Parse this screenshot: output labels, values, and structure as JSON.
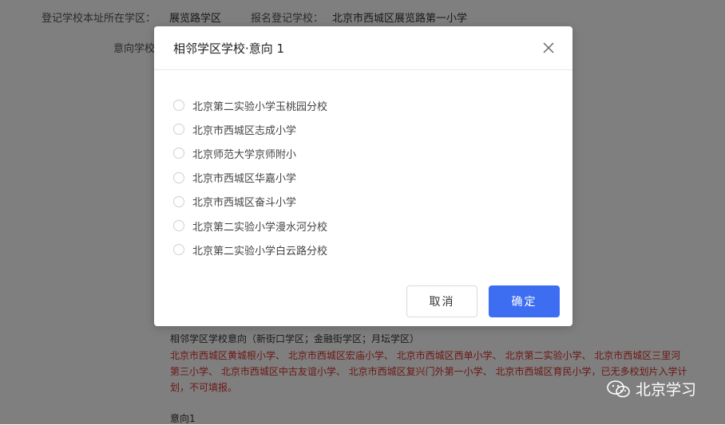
{
  "background": {
    "registered_district_label": "登记学校本址所在学区：",
    "registered_district_value": "展览路学区",
    "registered_school_label": "报名登记学校：",
    "registered_school_value": "北京市西城区展览路第一小学",
    "intent_school_label": "意向学校",
    "adjacent_heading": "相邻学区学校意向（新街口学区；金融街学区；月坛学区）",
    "adjacent_notice": "北京市西城区黄城根小学、 北京市西城区宏庙小学、 北京市西城区西单小学、 北京第二实验小学、 北京市西城区三里河第三小学、 北京市西城区中古友谊小学、 北京市西城区复兴门外第一小学、 北京市西城区育民小学，已无多校划片入学计划，不可填报。",
    "intent_1_label": "意向1"
  },
  "dialog": {
    "title": "相邻学区学校·意向 1",
    "options": [
      {
        "label": "北京第二实验小学玉桃园分校"
      },
      {
        "label": "北京市西城区志成小学"
      },
      {
        "label": "北京师范大学京师附小"
      },
      {
        "label": "北京市西城区华嘉小学"
      },
      {
        "label": "北京市西城区奋斗小学"
      },
      {
        "label": "北京第二实验小学漫水河分校"
      },
      {
        "label": "北京第二实验小学白云路分校"
      }
    ],
    "cancel_label": "取消",
    "confirm_label": "确定"
  },
  "watermark": {
    "text": "北京学习"
  },
  "colors": {
    "primary": "#3d6df0",
    "notice_red": "#d9302a"
  }
}
